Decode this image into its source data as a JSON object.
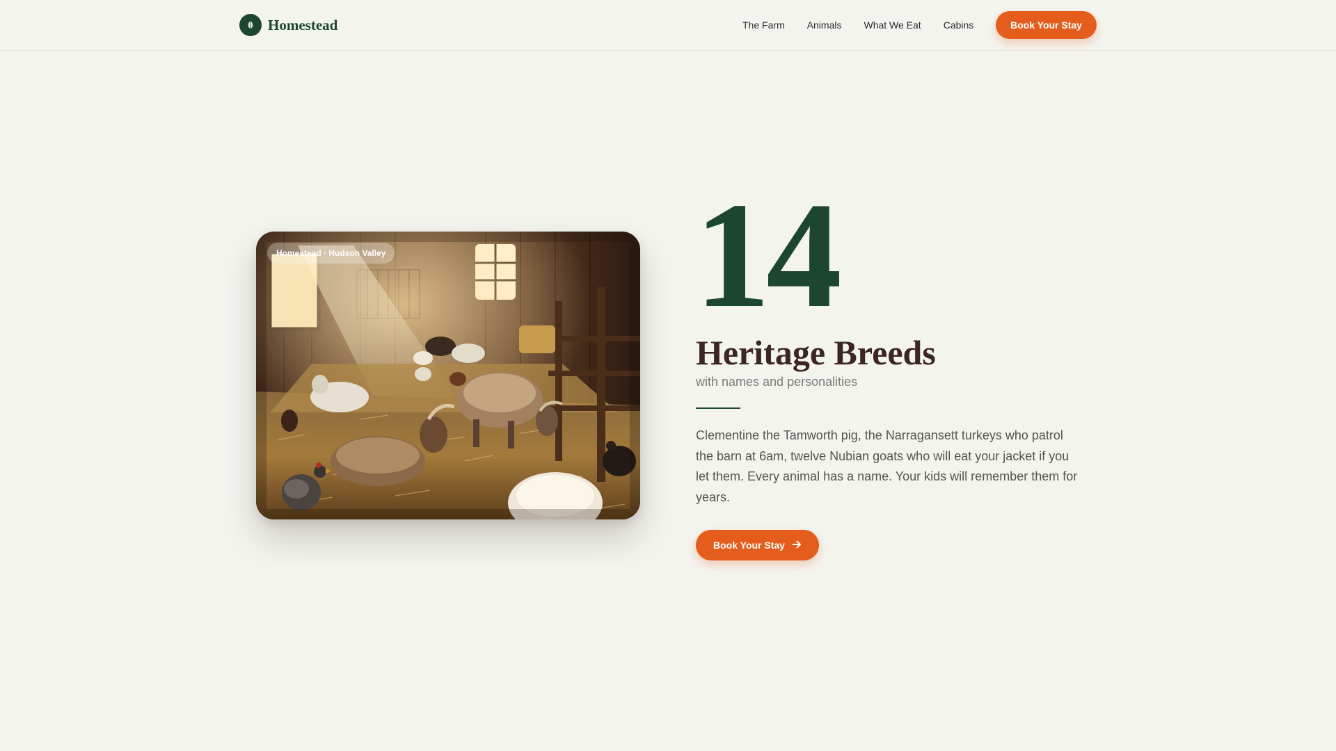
{
  "header": {
    "brand": "Homestead",
    "brand_icon": "leaf-icon",
    "nav": [
      "The Farm",
      "Animals",
      "What We Eat",
      "Cabins"
    ],
    "cta_label": "Book Your Stay"
  },
  "hero": {
    "image_tag": "Homestead · Hudson Valley",
    "stat_number": "14",
    "stat_title": "Heritage Breeds",
    "stat_subtitle": "with names and personalities",
    "body": "Clementine the Tamworth pig, the Narragansett turkeys who patrol the barn at 6am, twelve Nubian goats who will eat your jacket if you let them. Every animal has a name. Your kids will remember them for years.",
    "cta_label": "Book Your Stay",
    "cta_icon": "arrow-right-icon"
  },
  "colors": {
    "background": "#f4f4ef",
    "brand_green": "#1d4631",
    "accent_orange": "#e45d1c",
    "title_brown": "#3b2622"
  }
}
